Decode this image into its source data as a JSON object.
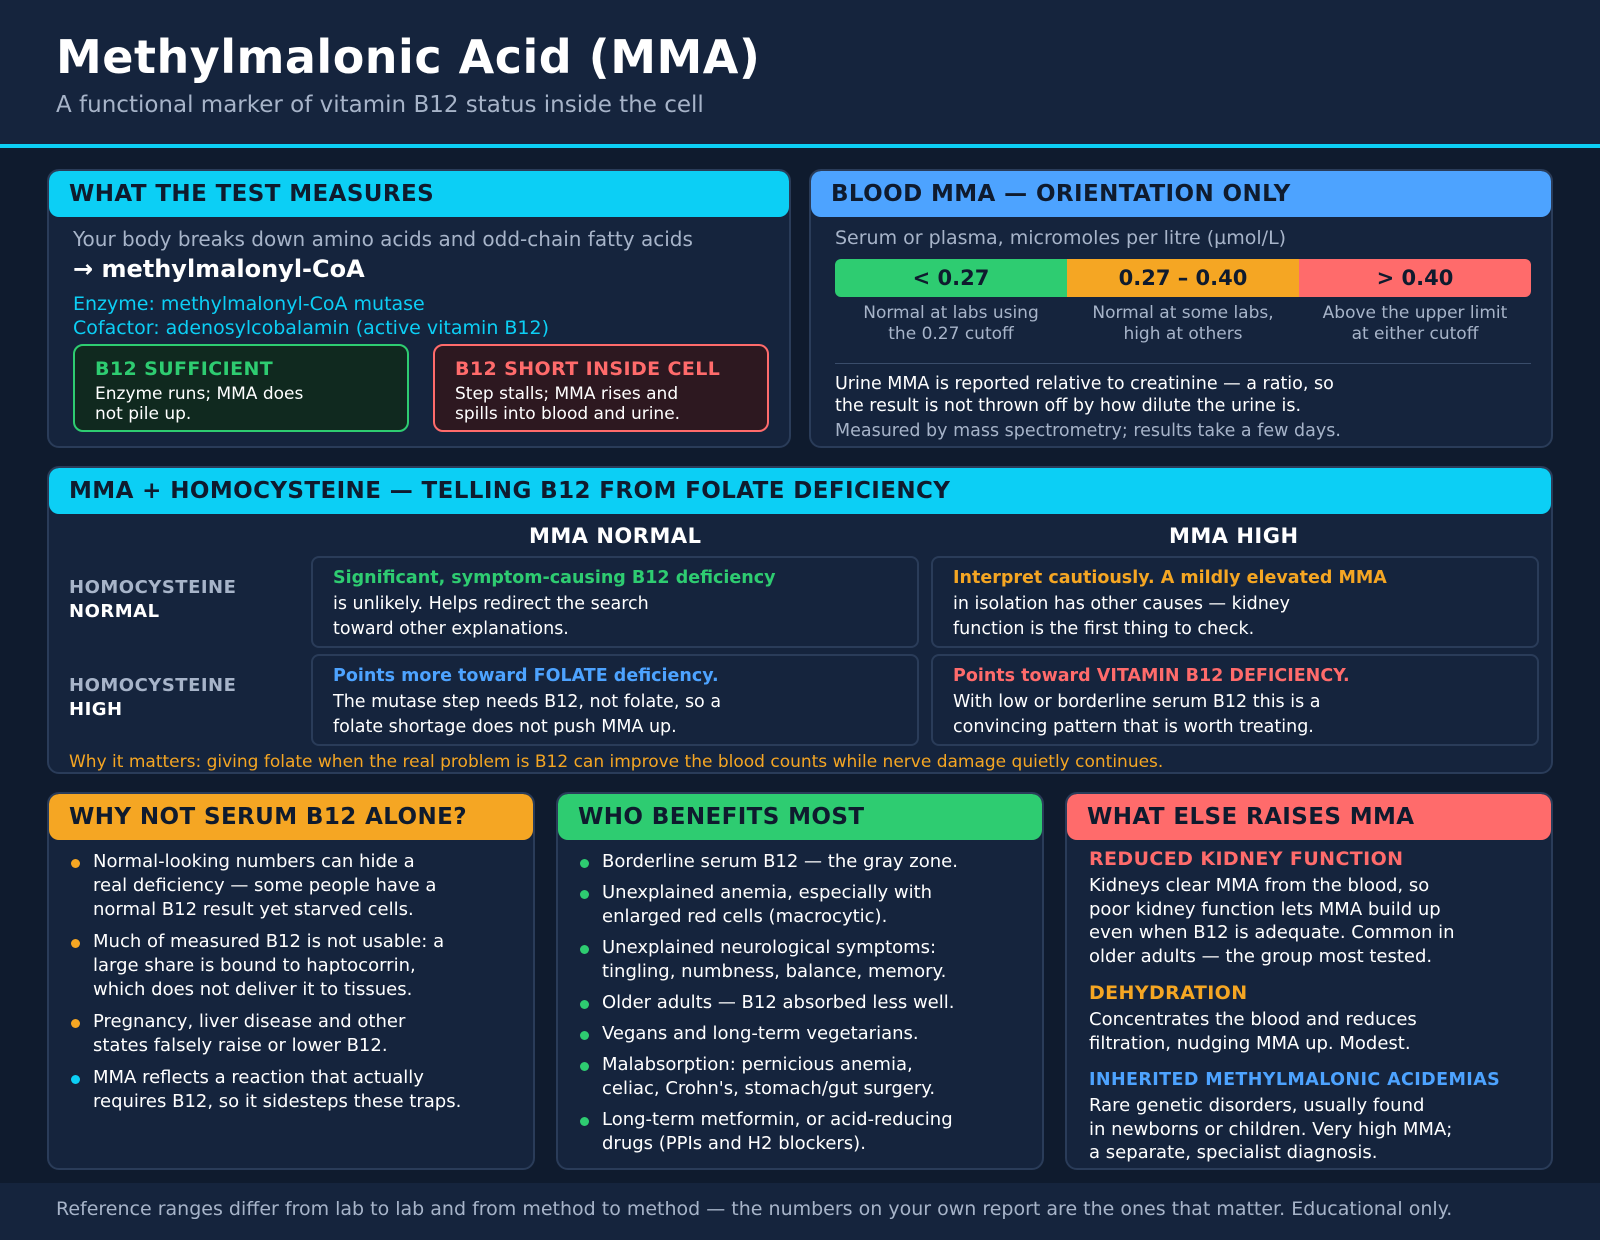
{
  "header": {
    "title": "Methylmalonic Acid (MMA)",
    "subtitle": "A functional marker of vitamin B12 status inside the cell"
  },
  "measures": {
    "heading": "WHAT THE TEST MEASURES",
    "intro": "Your body breaks down amino acids and odd-chain fatty acids",
    "product": "→ methylmalonyl-CoA",
    "enzyme": "Enzyme: methylmalonyl-CoA mutase",
    "cofactor": "Cofactor: adenosylcobalamin (active vitamin B12)",
    "sufficient": {
      "title": "B12 SUFFICIENT",
      "line1": "Enzyme runs; MMA does",
      "line2": "not pile up."
    },
    "short": {
      "title": "B12 SHORT INSIDE CELL",
      "line1": "Step stalls; MMA rises and",
      "line2": "spills into blood and urine."
    }
  },
  "blood": {
    "heading": "BLOOD MMA — ORIENTATION ONLY",
    "unit": "Serum or plasma, micromoles per litre (µmol/L)",
    "ranges": [
      {
        "label": "< 0.27",
        "line1": "Normal at labs using",
        "line2": "the 0.27 cutoff",
        "color": "#2ecc71"
      },
      {
        "label": "0.27 – 0.40",
        "line1": "Normal at some labs,",
        "line2": "high at others",
        "color": "#f5a623"
      },
      {
        "label": "> 0.40",
        "line1": "Above the upper limit",
        "line2": "at either cutoff",
        "color": "#ff6b6b"
      }
    ],
    "urine_line1": "Urine MMA is reported relative to creatinine — a ratio, so",
    "urine_line2": "the result is not thrown off by how dilute the urine is.",
    "method": "Measured by mass spectrometry; results take a few days."
  },
  "matrix": {
    "heading": "MMA + HOMOCYSTEINE — TELLING B12 FROM FOLATE DEFICIENCY",
    "col_headers": [
      "MMA NORMAL",
      "MMA HIGH"
    ],
    "row_headers": [
      {
        "a": "HOMOCYSTEINE",
        "b": "NORMAL"
      },
      {
        "a": "HOMOCYSTEINE",
        "b": "HIGH"
      }
    ],
    "cells": [
      {
        "title": "Significant, symptom-causing B12 deficiency",
        "line1": "is unlikely. Helps redirect the search",
        "line2": "toward other explanations."
      },
      {
        "title": "Interpret cautiously. A mildly elevated MMA",
        "line1": "in isolation has other causes — kidney",
        "line2": "function is the first thing to check."
      },
      {
        "title": "Points more toward FOLATE deficiency.",
        "line1": "The mutase step needs B12, not folate, so a",
        "line2": "folate shortage does not push MMA up."
      },
      {
        "title": "Points toward VITAMIN B12 DEFICIENCY.",
        "line1": "With low or borderline serum B12 this is a",
        "line2": "convincing pattern that is worth treating."
      }
    ],
    "note": "Why it matters: giving folate when the real problem is B12 can improve the blood counts while nerve damage quietly continues."
  },
  "why_not": {
    "heading": "WHY NOT SERUM B12 ALONE?",
    "items": [
      {
        "l1": "Normal-looking numbers can hide a",
        "l2": "real deficiency — some people have a",
        "l3": "normal B12 result yet starved cells."
      },
      {
        "l1": "Much of measured B12 is not usable: a",
        "l2": "large share is bound to haptocorrin,",
        "l3": "which does not deliver it to tissues."
      },
      {
        "l1": "Pregnancy, liver disease and other",
        "l2": "states falsely raise or lower B12."
      },
      {
        "l1": "MMA reflects a reaction that actually",
        "l2": "requires B12, so it sidesteps these traps."
      }
    ]
  },
  "who": {
    "heading": "WHO BENEFITS MOST",
    "items": [
      {
        "l1": "Borderline serum B12 — the gray zone."
      },
      {
        "l1": "Unexplained anemia, especially with",
        "l2": "enlarged red cells (macrocytic)."
      },
      {
        "l1": "Unexplained neurological symptoms:",
        "l2": "tingling, numbness, balance, memory."
      },
      {
        "l1": "Older adults — B12 absorbed less well."
      },
      {
        "l1": "Vegans and long-term vegetarians."
      },
      {
        "l1": "Malabsorption: pernicious anemia,",
        "l2": "celiac, Crohn's, stomach/gut surgery."
      },
      {
        "l1": "Long-term metformin, or acid-reducing",
        "l2": "drugs (PPIs and H2 blockers)."
      }
    ]
  },
  "else": {
    "heading": "WHAT ELSE RAISES MMA",
    "causes": [
      {
        "title": "REDUCED KIDNEY FUNCTION",
        "l1": "Kidneys clear MMA from the blood, so",
        "l2": "poor kidney function lets MMA build up",
        "l3": "even when B12 is adequate. Common in",
        "l4": "older adults — the group most tested."
      },
      {
        "title": "DEHYDRATION",
        "l1": "Concentrates the blood and reduces",
        "l2": "filtration, nudging MMA up. Modest."
      },
      {
        "title": "INHERITED METHYLMALONIC ACIDEMIAS",
        "l1": "Rare genetic disorders, usually found",
        "l2": "in newborns or children. Very high MMA;",
        "l3": "a separate, specialist diagnosis."
      }
    ]
  },
  "footer": "Reference ranges differ from lab to lab and from method to method — the numbers on your own report are the ones that matter. Educational only."
}
